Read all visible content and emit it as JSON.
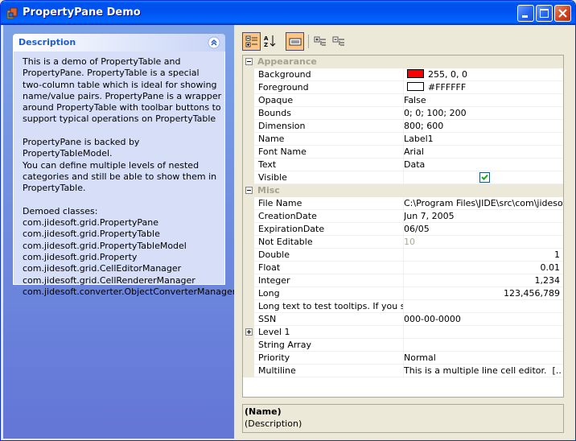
{
  "window": {
    "title": "PropertyPane Demo"
  },
  "description": {
    "title": "Description",
    "text": "This is a demo of PropertyTable and\nPropertyPane. PropertyTable is a special\ntwo-column table which is ideal for showing\nname/value pairs. PropertyPane is a wrapper\naround PropertyTable with toolbar buttons to\nsupport typical operations on PropertyTable\n\nPropertyPane is backed by PropertyTableModel.\nYou can define multiple levels of nested\ncategories and still be able to show them in\nPropertyTable.\n\nDemoed classes:\ncom.jidesoft.grid.PropertyPane\ncom.jidesoft.grid.PropertyTable\ncom.jidesoft.grid.PropertyTableModel\ncom.jidesoft.grid.Property\ncom.jidesoft.grid.CellEditorManager\ncom.jidesoft.grid.CellRendererManager\ncom.jidesoft.converter.ObjectConverterManager"
  },
  "toolbar": {
    "buttons": [
      {
        "icon": "categorized-view-icon",
        "active": true
      },
      {
        "icon": "sort-alphabetical-icon",
        "active": false
      },
      {
        "icon": "description-toggle-icon",
        "active": true
      },
      {
        "icon": "expand-all-icon",
        "active": false
      },
      {
        "icon": "collapse-all-icon",
        "active": false
      }
    ]
  },
  "categories": {
    "appearance": "Appearance",
    "misc": "Misc"
  },
  "properties": {
    "background": {
      "name": "Background",
      "value": "255, 0, 0",
      "color": "#ff0000"
    },
    "foreground": {
      "name": "Foreground",
      "value": "#FFFFFF",
      "color": "#ffffff"
    },
    "opaque": {
      "name": "Opaque",
      "value": "False"
    },
    "bounds": {
      "name": "Bounds",
      "value": "0; 0; 100; 200"
    },
    "dimension": {
      "name": "Dimension",
      "value": "800; 600"
    },
    "name": {
      "name": "Name",
      "value": "Label1"
    },
    "font_name": {
      "name": "Font Name",
      "value": "Arial"
    },
    "text": {
      "name": "Text",
      "value": "Data"
    },
    "visible": {
      "name": "Visible",
      "checked": true
    },
    "file_name": {
      "name": "File Name",
      "value": "C:\\Program Files\\JIDE\\src\\com\\jidesoft\\..."
    },
    "creation_date": {
      "name": "CreationDate",
      "value": "Jun 7, 2005"
    },
    "expiration_date": {
      "name": "ExpirationDate",
      "value": "06/05"
    },
    "not_editable": {
      "name": "Not Editable",
      "value": "10"
    },
    "double": {
      "name": "Double",
      "value": "1"
    },
    "float": {
      "name": "Float",
      "value": "0.01"
    },
    "integer": {
      "name": "Integer",
      "value": "1,234"
    },
    "long": {
      "name": "Long",
      "value": "123,456,789"
    },
    "long_text": {
      "name": "Long text to test tooltips. If you s...",
      "value": ""
    },
    "ssn": {
      "name": "SSN",
      "value": "000-00-0000"
    },
    "level1": {
      "name": "Level 1",
      "value": ""
    },
    "string_array": {
      "name": "String Array",
      "value": ""
    },
    "priority": {
      "name": "Priority",
      "value": "Normal"
    },
    "multiline": {
      "name": "Multiline",
      "value": "This is a multiple line cell editor.",
      "ellipsis": "[...]"
    }
  },
  "footer": {
    "name": "(Name)",
    "description": "(Description)"
  }
}
